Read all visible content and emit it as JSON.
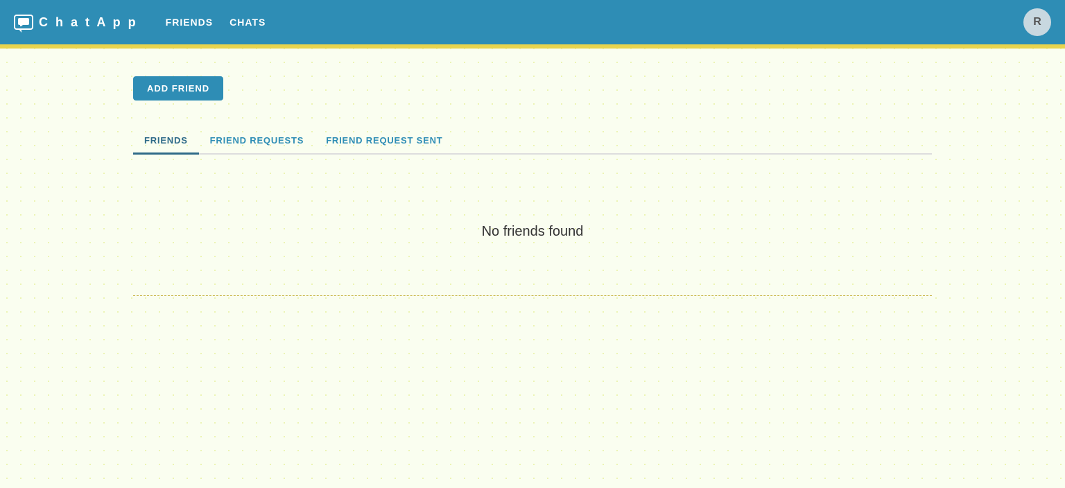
{
  "navbar": {
    "brand": {
      "icon_label": "chat-icon",
      "text": "C h a t   A p p"
    },
    "nav_links": [
      {
        "label": "FRIENDS",
        "href": "#friends"
      },
      {
        "label": "CHATS",
        "href": "#chats"
      }
    ],
    "avatar": {
      "letter": "R"
    }
  },
  "main": {
    "add_friend_button": "ADD FRIEND",
    "tabs": [
      {
        "label": "FRIENDS",
        "active": true
      },
      {
        "label": "FRIEND REQUESTS",
        "active": false
      },
      {
        "label": "FRIEND REQUEST SENT",
        "active": false
      }
    ],
    "empty_state_message": "No friends found"
  },
  "colors": {
    "navbar_bg": "#2e8db5",
    "yellow_bar": "#e8d44d",
    "active_tab_color": "#2e6a88",
    "tab_color": "#2e8db5"
  }
}
